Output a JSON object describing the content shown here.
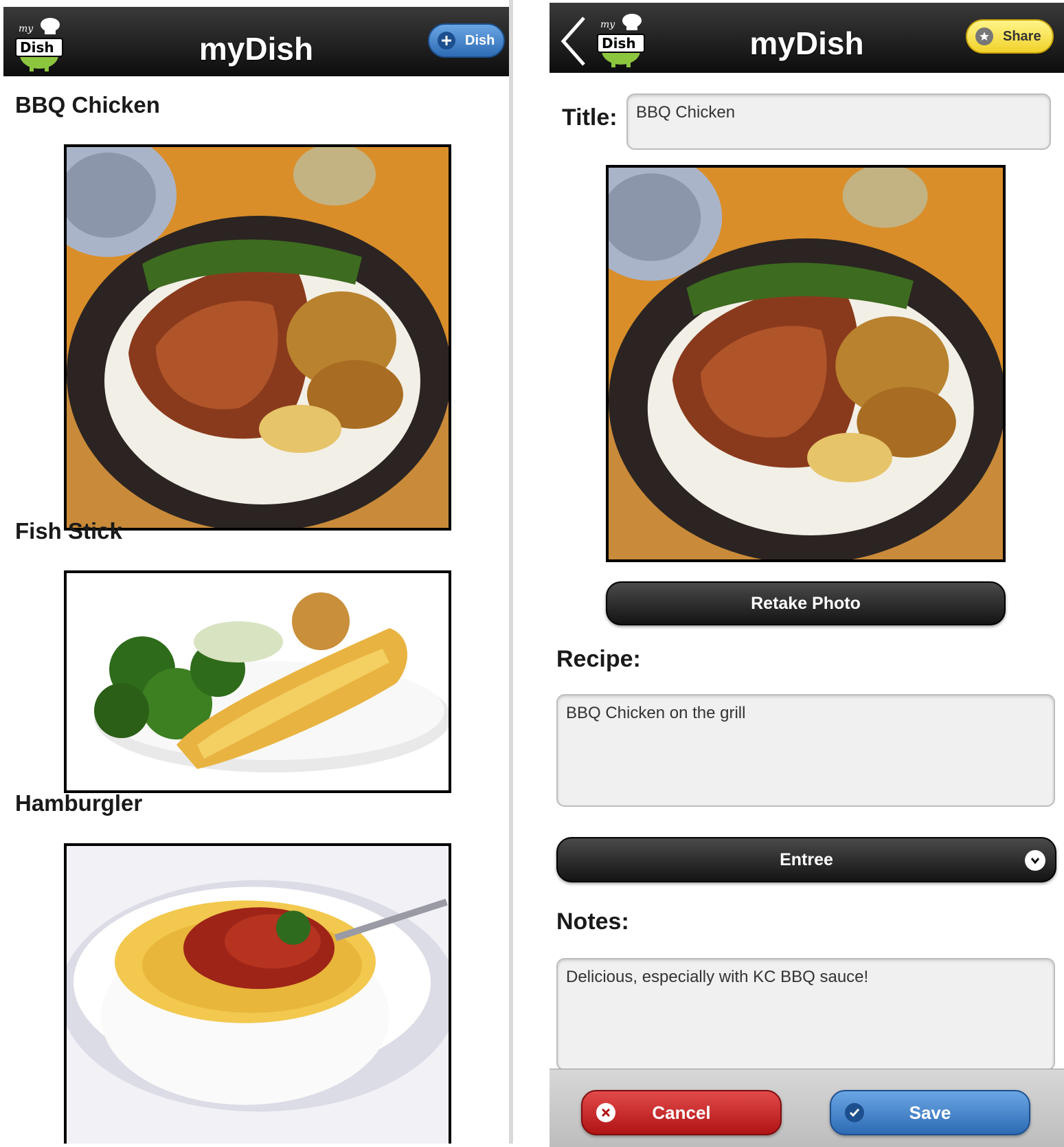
{
  "list_screen": {
    "app_title": "myDish",
    "logo_text": "my Dish",
    "add_dish_button": {
      "icon": "plus-icon",
      "label": "Dish"
    },
    "dishes": [
      {
        "title": "BBQ Chicken"
      },
      {
        "title": "Fish Stick"
      },
      {
        "title": "Hamburgler"
      }
    ]
  },
  "edit_screen": {
    "app_title": "myDish",
    "logo_text": "my Dish",
    "share_button": {
      "icon": "star-icon",
      "label": "Share"
    },
    "title_label": "Title:",
    "title_value": "BBQ Chicken",
    "retake_photo_label": "Retake Photo",
    "recipe_label": "Recipe:",
    "recipe_value": "BBQ Chicken on the grill",
    "category_selected": "Entree",
    "notes_label": "Notes:",
    "notes_value": "Delicious, especially with KC BBQ sauce!",
    "cancel_label": "Cancel",
    "save_label": "Save"
  },
  "colors": {
    "header": "#1a1a1a",
    "blue_button": "#2d6bb4",
    "yellow_button": "#f1d22b",
    "red_button": "#c81e1e"
  }
}
